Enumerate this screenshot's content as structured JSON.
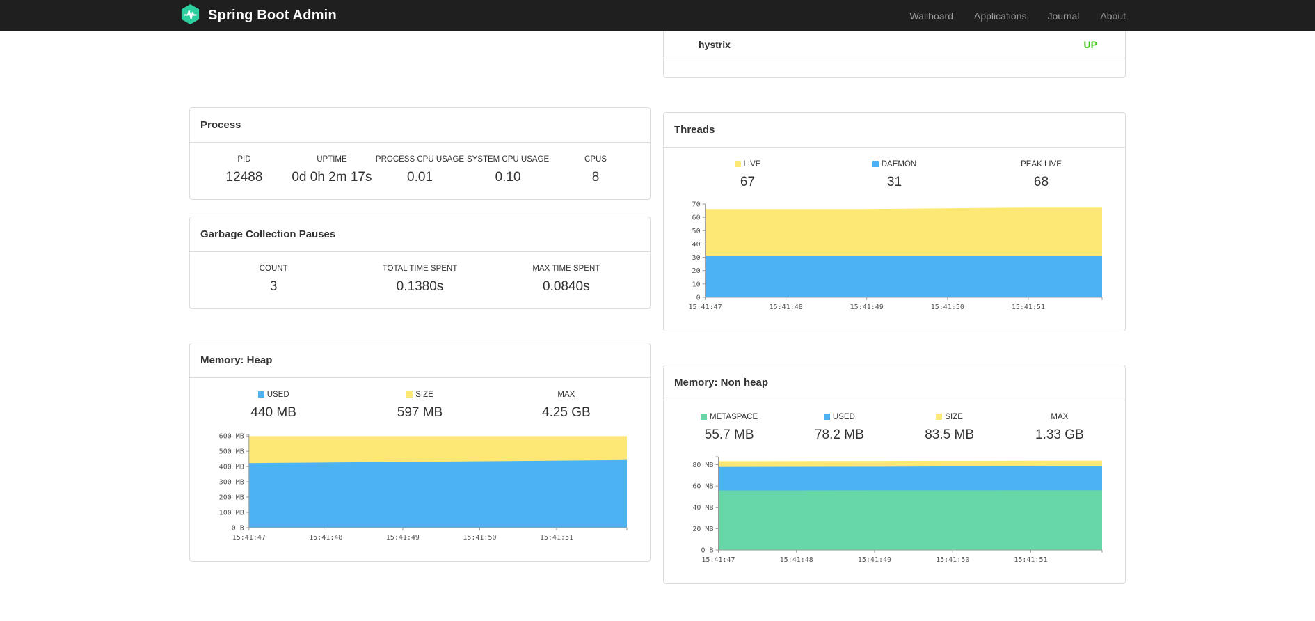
{
  "navbar": {
    "brand": "Spring Boot Admin",
    "links": [
      "Wallboard",
      "Applications",
      "Journal",
      "About"
    ]
  },
  "application_card": {
    "name": "hystrix",
    "status": "UP",
    "status_color": "#42c31c"
  },
  "panels": {
    "process": {
      "title": "Process",
      "metrics": [
        {
          "label": "PID",
          "value": "12488"
        },
        {
          "label": "UPTIME",
          "value": "0d 0h 2m 17s"
        },
        {
          "label": "PROCESS CPU USAGE",
          "value": "0.01"
        },
        {
          "label": "SYSTEM CPU USAGE",
          "value": "0.10"
        },
        {
          "label": "CPUS",
          "value": "8"
        }
      ]
    },
    "gc": {
      "title": "Garbage Collection Pauses",
      "metrics": [
        {
          "label": "COUNT",
          "value": "3"
        },
        {
          "label": "TOTAL TIME SPENT",
          "value": "0.1380s"
        },
        {
          "label": "MAX TIME SPENT",
          "value": "0.0840s"
        }
      ]
    },
    "threads": {
      "title": "Threads",
      "legend": [
        {
          "label": "LIVE",
          "value": "67",
          "color": "#fde876"
        },
        {
          "label": "DAEMON",
          "value": "31",
          "color": "#4cb2f2"
        },
        {
          "label": "PEAK LIVE",
          "value": "68"
        }
      ]
    },
    "memory_heap": {
      "title": "Memory: Heap",
      "legend": [
        {
          "label": "USED",
          "value": "440 MB",
          "color": "#4cb2f2"
        },
        {
          "label": "SIZE",
          "value": "597 MB",
          "color": "#fde876"
        },
        {
          "label": "MAX",
          "value": "4.25 GB"
        }
      ]
    },
    "memory_nonheap": {
      "title": "Memory: Non heap",
      "legend": [
        {
          "label": "METASPACE",
          "value": "55.7 MB",
          "color": "#67d7a8"
        },
        {
          "label": "USED",
          "value": "78.2 MB",
          "color": "#4cb2f2"
        },
        {
          "label": "SIZE",
          "value": "83.5 MB",
          "color": "#fde876"
        },
        {
          "label": "MAX",
          "value": "1.33 GB"
        }
      ]
    }
  },
  "chart_data": [
    {
      "id": "threads",
      "type": "area",
      "x_labels": [
        "15:41:47",
        "15:41:48",
        "15:41:49",
        "15:41:50",
        "15:41:51"
      ],
      "y_ticks": {
        "values": [
          0,
          10,
          20,
          30,
          40,
          50,
          60,
          70
        ],
        "labels": [
          "0",
          "10",
          "20",
          "30",
          "40",
          "50",
          "60",
          "70"
        ]
      },
      "ylim": [
        0,
        70
      ],
      "series": [
        {
          "name": "LIVE",
          "color": "#fde876",
          "values": [
            66,
            66,
            66,
            66.5,
            67,
            67
          ]
        },
        {
          "name": "DAEMON",
          "color": "#4cb2f2",
          "values": [
            31,
            31,
            31,
            31,
            31,
            31
          ]
        }
      ]
    },
    {
      "id": "memory-heap",
      "type": "area",
      "x_labels": [
        "15:41:47",
        "15:41:48",
        "15:41:49",
        "15:41:50",
        "15:41:51"
      ],
      "y_ticks": {
        "values": [
          0,
          100,
          200,
          300,
          400,
          500,
          600
        ],
        "labels": [
          "0 B",
          "100 MB",
          "200 MB",
          "300 MB",
          "400 MB",
          "500 MB",
          "600 MB"
        ]
      },
      "ylim": [
        0,
        610
      ],
      "series": [
        {
          "name": "SIZE",
          "color": "#fde876",
          "values": [
            597,
            597,
            597,
            597,
            597,
            597
          ]
        },
        {
          "name": "USED",
          "color": "#4cb2f2",
          "values": [
            420,
            424,
            428,
            432,
            436,
            440
          ]
        }
      ]
    },
    {
      "id": "memory-nonheap",
      "type": "area",
      "x_labels": [
        "15:41:47",
        "15:41:48",
        "15:41:49",
        "15:41:50",
        "15:41:51"
      ],
      "y_ticks": {
        "values": [
          0,
          20,
          40,
          60,
          80
        ],
        "labels": [
          "0 B",
          "20 MB",
          "40 MB",
          "60 MB",
          "80 MB"
        ]
      },
      "ylim": [
        0,
        87.5
      ],
      "series": [
        {
          "name": "SIZE",
          "color": "#fde876",
          "values": [
            83.0,
            83.1,
            83.2,
            83.3,
            83.4,
            83.5
          ]
        },
        {
          "name": "USED",
          "color": "#4cb2f2",
          "values": [
            77.6,
            77.7,
            77.8,
            78.0,
            78.1,
            78.2
          ]
        },
        {
          "name": "METASPACE",
          "color": "#67d7a8",
          "values": [
            55.5,
            55.5,
            55.6,
            55.6,
            55.7,
            55.7
          ]
        }
      ]
    }
  ]
}
